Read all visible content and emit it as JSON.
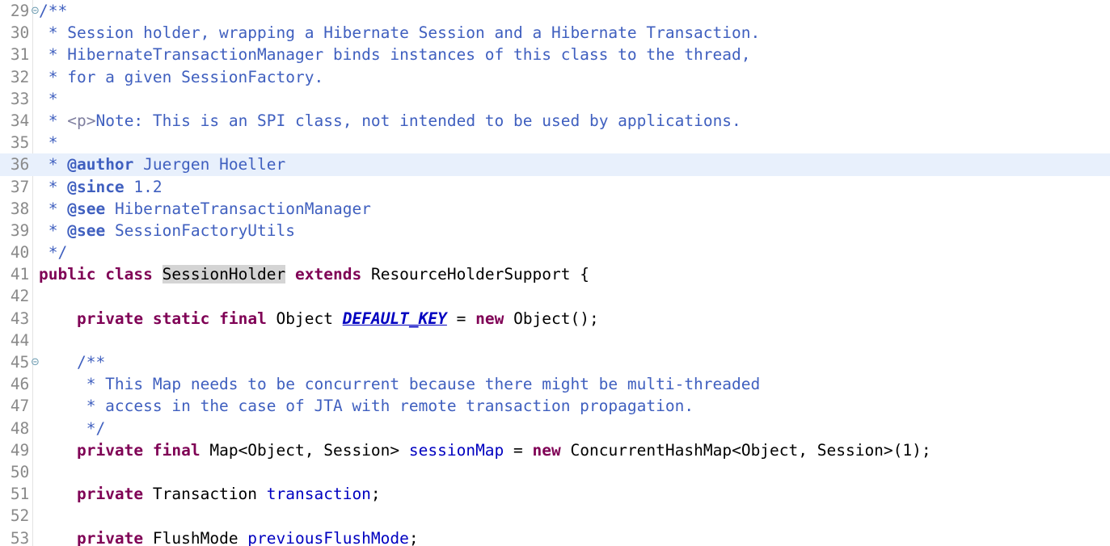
{
  "editor": {
    "language": "java",
    "font_size_px": 19.5,
    "line_height_px": 27.2,
    "current_line": 36,
    "colors": {
      "background": "#ffffff",
      "current_line_highlight": "#e8f0fc",
      "line_number": "#8a8a8a",
      "gutter_separator": "#e2e2e2",
      "keyword": "#7f0055",
      "javadoc_comment": "#3f5fbf",
      "javadoc_html_tag": "#7f7f9f",
      "field": "#0000c0",
      "static_final_field": "#0000c0",
      "plain_text": "#000000",
      "occurrence_highlight": "#d4d4d4",
      "fold_marker": "#6a9ab0"
    },
    "fold_marker_glyph": "⊝",
    "folded_lines": [
      29,
      45
    ]
  },
  "lines": [
    {
      "number": "29",
      "fold": true,
      "highlighted": false,
      "tokens": [
        {
          "text": "/**",
          "type": "cmt"
        }
      ]
    },
    {
      "number": "30",
      "fold": false,
      "highlighted": false,
      "tokens": [
        {
          "text": " * Session holder, wrapping a Hibernate Session and a Hibernate Transaction.",
          "type": "cmt"
        }
      ]
    },
    {
      "number": "31",
      "fold": false,
      "highlighted": false,
      "tokens": [
        {
          "text": " * HibernateTransactionManager binds instances of this class to the thread,",
          "type": "cmt"
        }
      ]
    },
    {
      "number": "32",
      "fold": false,
      "highlighted": false,
      "tokens": [
        {
          "text": " * for a given SessionFactory.",
          "type": "cmt"
        }
      ]
    },
    {
      "number": "33",
      "fold": false,
      "highlighted": false,
      "tokens": [
        {
          "text": " *",
          "type": "cmt"
        }
      ]
    },
    {
      "number": "34",
      "fold": false,
      "highlighted": false,
      "tokens": [
        {
          "text": " * ",
          "type": "cmt"
        },
        {
          "text": "<p>",
          "type": "cmt-html"
        },
        {
          "text": "Note: This is an SPI class, not intended to be used by applications.",
          "type": "cmt"
        }
      ]
    },
    {
      "number": "35",
      "fold": false,
      "highlighted": false,
      "tokens": [
        {
          "text": " *",
          "type": "cmt"
        }
      ]
    },
    {
      "number": "36",
      "fold": false,
      "highlighted": true,
      "tokens": [
        {
          "text": " * ",
          "type": "cmt"
        },
        {
          "text": "@author",
          "type": "cmt-tag"
        },
        {
          "text": " Juergen Hoeller",
          "type": "cmt"
        }
      ]
    },
    {
      "number": "37",
      "fold": false,
      "highlighted": false,
      "tokens": [
        {
          "text": " * ",
          "type": "cmt"
        },
        {
          "text": "@since",
          "type": "cmt-tag"
        },
        {
          "text": " 1.2",
          "type": "cmt"
        }
      ]
    },
    {
      "number": "38",
      "fold": false,
      "highlighted": false,
      "tokens": [
        {
          "text": " * ",
          "type": "cmt"
        },
        {
          "text": "@see",
          "type": "cmt-tag"
        },
        {
          "text": " HibernateTransactionManager",
          "type": "cmt"
        }
      ]
    },
    {
      "number": "39",
      "fold": false,
      "highlighted": false,
      "tokens": [
        {
          "text": " * ",
          "type": "cmt"
        },
        {
          "text": "@see",
          "type": "cmt-tag"
        },
        {
          "text": " SessionFactoryUtils",
          "type": "cmt"
        }
      ]
    },
    {
      "number": "40",
      "fold": false,
      "highlighted": false,
      "tokens": [
        {
          "text": " */",
          "type": "cmt"
        }
      ]
    },
    {
      "number": "41",
      "fold": false,
      "highlighted": false,
      "tokens": [
        {
          "text": "public",
          "type": "kw"
        },
        {
          "text": " ",
          "type": "plain"
        },
        {
          "text": "class",
          "type": "kw"
        },
        {
          "text": " ",
          "type": "plain"
        },
        {
          "text": "SessionHolder",
          "type": "occ"
        },
        {
          "text": " ",
          "type": "plain"
        },
        {
          "text": "extends",
          "type": "kw"
        },
        {
          "text": " ResourceHolderSupport {",
          "type": "plain"
        }
      ]
    },
    {
      "number": "42",
      "fold": false,
      "highlighted": false,
      "tokens": []
    },
    {
      "number": "43",
      "fold": false,
      "highlighted": false,
      "tokens": [
        {
          "text": "    ",
          "type": "plain"
        },
        {
          "text": "private",
          "type": "kw"
        },
        {
          "text": " ",
          "type": "plain"
        },
        {
          "text": "static",
          "type": "kw"
        },
        {
          "text": " ",
          "type": "plain"
        },
        {
          "text": "final",
          "type": "kw"
        },
        {
          "text": " Object ",
          "type": "plain"
        },
        {
          "text": "DEFAULT_KEY",
          "type": "sfld"
        },
        {
          "text": " = ",
          "type": "plain"
        },
        {
          "text": "new",
          "type": "kw"
        },
        {
          "text": " Object();",
          "type": "plain"
        }
      ]
    },
    {
      "number": "44",
      "fold": false,
      "highlighted": false,
      "tokens": []
    },
    {
      "number": "45",
      "fold": true,
      "highlighted": false,
      "tokens": [
        {
          "text": "    /**",
          "type": "cmt"
        }
      ]
    },
    {
      "number": "46",
      "fold": false,
      "highlighted": false,
      "tokens": [
        {
          "text": "     * This Map needs to be concurrent because there might be multi-threaded",
          "type": "cmt"
        }
      ]
    },
    {
      "number": "47",
      "fold": false,
      "highlighted": false,
      "tokens": [
        {
          "text": "     * access in the case of JTA with remote transaction propagation.",
          "type": "cmt"
        }
      ]
    },
    {
      "number": "48",
      "fold": false,
      "highlighted": false,
      "tokens": [
        {
          "text": "     */",
          "type": "cmt"
        }
      ]
    },
    {
      "number": "49",
      "fold": false,
      "highlighted": false,
      "tokens": [
        {
          "text": "    ",
          "type": "plain"
        },
        {
          "text": "private",
          "type": "kw"
        },
        {
          "text": " ",
          "type": "plain"
        },
        {
          "text": "final",
          "type": "kw"
        },
        {
          "text": " Map<Object, Session> ",
          "type": "plain"
        },
        {
          "text": "sessionMap",
          "type": "fld"
        },
        {
          "text": " = ",
          "type": "plain"
        },
        {
          "text": "new",
          "type": "kw"
        },
        {
          "text": " ConcurrentHashMap<Object, Session>(1);",
          "type": "plain"
        }
      ]
    },
    {
      "number": "50",
      "fold": false,
      "highlighted": false,
      "tokens": []
    },
    {
      "number": "51",
      "fold": false,
      "highlighted": false,
      "tokens": [
        {
          "text": "    ",
          "type": "plain"
        },
        {
          "text": "private",
          "type": "kw"
        },
        {
          "text": " Transaction ",
          "type": "plain"
        },
        {
          "text": "transaction",
          "type": "fld"
        },
        {
          "text": ";",
          "type": "plain"
        }
      ]
    },
    {
      "number": "52",
      "fold": false,
      "highlighted": false,
      "tokens": []
    },
    {
      "number": "53",
      "fold": false,
      "highlighted": false,
      "tokens": [
        {
          "text": "    ",
          "type": "plain"
        },
        {
          "text": "private",
          "type": "kw"
        },
        {
          "text": " FlushMode ",
          "type": "plain"
        },
        {
          "text": "previousFlushMode",
          "type": "fld"
        },
        {
          "text": ";",
          "type": "plain"
        }
      ]
    }
  ]
}
